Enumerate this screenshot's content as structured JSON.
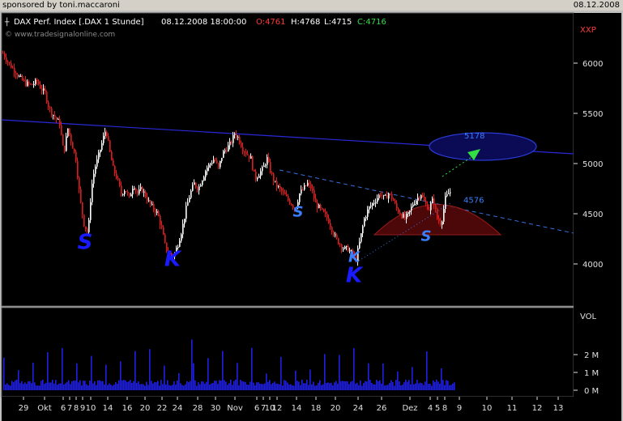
{
  "header": {
    "sponsor": "sponsored by toni.maccaroni",
    "date": "08.12.2008"
  },
  "info_bar": {
    "title": "DAX Perf. Index [.DAX  1 Stunde]",
    "datetime": "08.12.2008 18:00:00",
    "open": "O:4761",
    "high": "H:4768",
    "low": "L:4715",
    "close": "C:4716",
    "website": "© www.tradesignalonline.com",
    "symbol": "XXP"
  },
  "colors": {
    "background": "#000000",
    "panel_border": "#5a5a5a",
    "up_candle": "#ffffff",
    "down_candle": "#e11b1b",
    "trendline": "#2929d9",
    "neckline": "#3a6fe0",
    "volume": "#1f1fe6",
    "label_s_k": "#1a1aff",
    "target_arrow": "#33dd44",
    "open_color": "#ff3a3a",
    "close_color": "#33dd44",
    "axis_text": "#e0e0e0"
  },
  "chart_data": [
    {
      "type": "line",
      "title": "DAX Perf. Index [.DAX  1 Stunde]",
      "ylim": [
        3850,
        6250
      ],
      "y_ticks": [
        6000,
        5500,
        5000,
        4500,
        4000
      ],
      "y_tick_labels": [
        "6000",
        "5500",
        "5000",
        "4500",
        "4000"
      ],
      "x_tick_labels": [
        "29",
        "Okt",
        "6",
        "7",
        "8",
        "9",
        "10",
        "14",
        "16",
        "20",
        "22",
        "24",
        "28",
        "30",
        "Nov",
        "6",
        "7",
        "10",
        "12",
        "14",
        "18",
        "20",
        "24",
        "26",
        "Dez",
        "4",
        "5",
        "8",
        "9",
        "10",
        "11",
        "12",
        "13"
      ],
      "x_tick_positions": [
        29,
        55,
        78,
        86,
        94,
        102,
        112,
        133,
        157,
        179,
        200,
        219,
        244,
        266,
        290,
        317,
        325,
        333,
        342,
        366,
        390,
        414,
        442,
        471,
        506,
        531,
        540,
        549,
        567,
        601,
        632,
        663,
        689
      ],
      "series": [
        {
          "x": [
            5,
            12,
            20,
            26,
            33,
            40,
            47,
            52,
            57,
            62,
            66,
            70,
            75,
            80,
            85,
            90,
            95,
            100,
            105,
            110,
            114,
            118,
            122,
            127,
            132,
            136,
            141,
            146,
            151,
            156,
            161,
            166,
            171,
            176,
            181,
            186,
            191,
            196,
            201,
            206,
            211,
            216,
            221,
            226,
            231,
            236,
            241,
            246,
            251,
            256,
            261,
            266,
            271,
            276,
            281,
            286,
            291,
            296,
            301,
            306,
            311,
            316,
            321,
            326,
            331,
            336,
            341,
            346,
            351,
            356,
            361,
            366,
            371,
            376,
            381,
            386,
            391,
            396,
            401,
            406,
            411,
            416,
            421,
            426,
            431,
            436,
            441,
            446,
            451,
            456,
            461,
            466,
            471,
            476,
            481,
            486,
            491,
            496,
            501,
            506,
            511,
            516,
            521,
            526,
            531,
            536,
            541,
            546,
            551,
            556
          ],
          "values": [
            6100,
            6000,
            5920,
            5850,
            5800,
            5780,
            5820,
            5750,
            5700,
            5550,
            5500,
            5450,
            5400,
            5100,
            5350,
            5200,
            5050,
            4650,
            4400,
            4300,
            4750,
            4950,
            5050,
            5200,
            5350,
            5150,
            4950,
            4850,
            4700,
            4750,
            4650,
            4800,
            4700,
            4750,
            4680,
            4600,
            4550,
            4500,
            4350,
            4150,
            4100,
            4080,
            4200,
            4350,
            4550,
            4700,
            4800,
            4750,
            4850,
            4950,
            5000,
            5050,
            4950,
            5100,
            5150,
            5200,
            5300,
            5250,
            5150,
            5100,
            5050,
            4850,
            4900,
            4950,
            5050,
            4900,
            4800,
            4750,
            4700,
            4650,
            4600,
            4550,
            4700,
            4750,
            4800,
            4750,
            4600,
            4550,
            4500,
            4450,
            4350,
            4250,
            4200,
            4150,
            4150,
            4100,
            4050,
            4250,
            4450,
            4550,
            4600,
            4650,
            4700,
            4650,
            4700,
            4650,
            4550,
            4500,
            4450,
            4500,
            4600,
            4650,
            4700,
            4600,
            4550,
            4650,
            4450,
            4400,
            4650,
            4716
          ]
        }
      ],
      "annotations": [
        {
          "text": "S",
          "x": 105,
          "y": 4150
        },
        {
          "text": "K",
          "x": 213,
          "y": 3980
        },
        {
          "text": "S",
          "x": 368,
          "y": 4470
        },
        {
          "text": "K",
          "x": 437,
          "y": 4020
        },
        {
          "text": "K",
          "x": 437,
          "y": 3820
        },
        {
          "text": "S",
          "x": 526,
          "y": 4230
        },
        {
          "text": "4576",
          "x": 572,
          "y": 4610
        },
        {
          "text": "5178",
          "x": 573,
          "y": 5250
        }
      ]
    },
    {
      "type": "bar",
      "title": "VOL",
      "ylim": [
        0,
        3000000
      ],
      "y_ticks": [
        2000000,
        1000000,
        0
      ],
      "y_tick_labels": [
        "2 M",
        "1 M",
        "0 M"
      ],
      "note": "Hourly volume bars, spikes at session openings"
    }
  ]
}
